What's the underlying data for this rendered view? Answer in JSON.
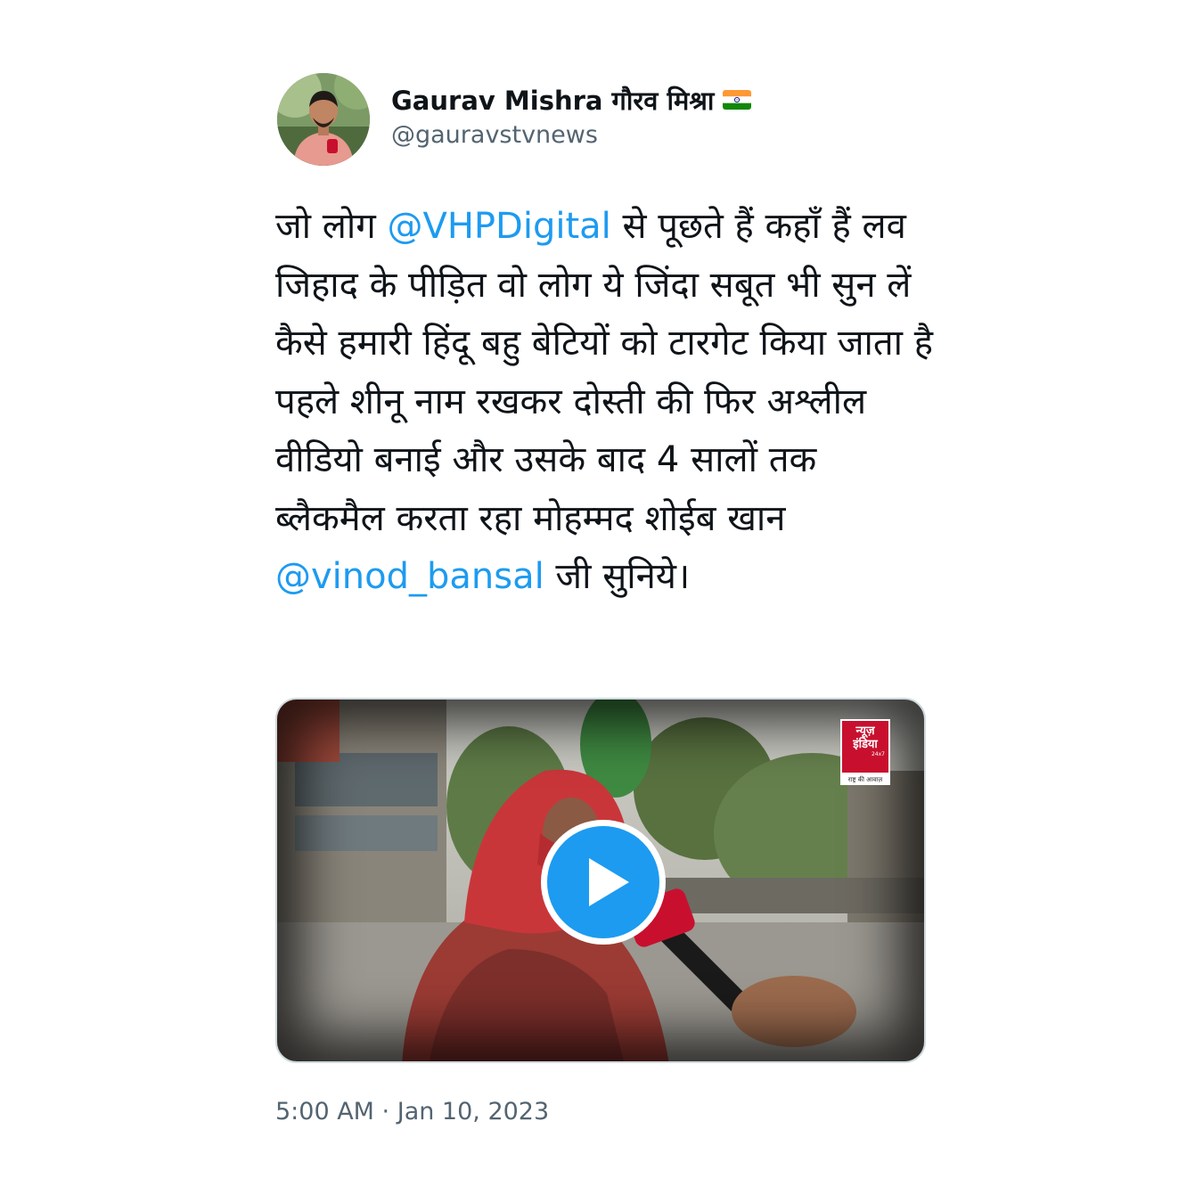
{
  "author": {
    "display_name": "Gaurav Mishra गौरव मिश्रा",
    "flag_icon": "india-flag-icon",
    "handle": "@gauravstvnews"
  },
  "tweet": {
    "segments": [
      {
        "text": "जो लोग ",
        "type": "text"
      },
      {
        "text": "@VHPDigital",
        "type": "mention"
      },
      {
        "text": " से पूछते हैं कहाँ हैं लव जिहाद के पीड़ित वो लोग ये जिंदा सबूत भी सुन लें कैसे हमारी हिंदू बहु बेटियों को टारगेट किया जाता है पहले शीनू नाम रखकर दोस्ती की फिर अश्लील वीडियो बनाई और उसके बाद 4 सालों तक ब्लैकमैल करता रहा मोहम्मद शोईब खान ",
        "type": "text"
      },
      {
        "text": "@vinod_bansal",
        "type": "mention"
      },
      {
        "text": " जी सुनिये।",
        "type": "text"
      }
    ],
    "timestamp": "5:00 AM · Jan 10, 2023"
  },
  "media": {
    "type": "video",
    "channel_logo": {
      "line1": "न्यूज़",
      "line2": "इंडिया",
      "line3": "24x7",
      "tagline": "राष्ट्र की आवाज़"
    },
    "play_icon": "play-icon"
  },
  "colors": {
    "mention": "#1d9bf0",
    "secondary_text": "#536471",
    "play_button": "#1d9bf0",
    "channel_red": "#c8102e"
  }
}
